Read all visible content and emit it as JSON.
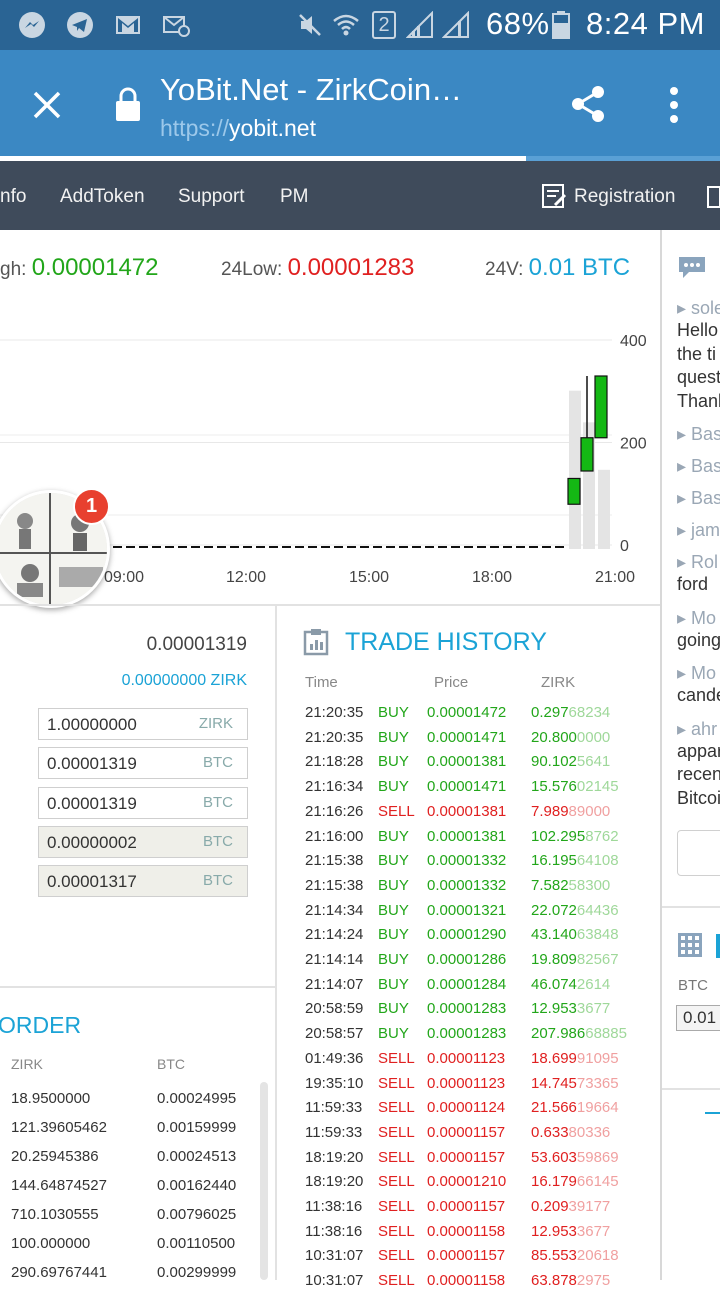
{
  "status_bar": {
    "battery": "68%",
    "time": "8:24 PM",
    "sim_badge": "2",
    "icons": [
      "messenger-icon",
      "telegram-icon",
      "gmail-icon",
      "email-icon",
      "mute-icon",
      "wifi-icon",
      "signal-icon",
      "battery-icon"
    ]
  },
  "browser": {
    "title": "YoBit.Net - ZirkCoin…",
    "url_scheme": "https://",
    "url_host": "yobit.net",
    "load_progress": 0.73
  },
  "nav": {
    "items": [
      "nfo",
      "AddToken",
      "Support",
      "PM"
    ],
    "registration": "Registration"
  },
  "stats": {
    "high_label": "gh:",
    "high_value": "0.00001472",
    "low_label": "24Low:",
    "low_value": "0.00001283",
    "vol_label": "24V:",
    "vol_value": "0.01 BTC"
  },
  "chart_data": {
    "type": "candlestick",
    "x_ticks": [
      "09:00",
      "12:00",
      "15:00",
      "18:00",
      "21:00"
    ],
    "y_ticks": [
      "400",
      "200",
      "0"
    ],
    "ylim": [
      0,
      400
    ],
    "candles": [
      {
        "open": 1283,
        "close": 1321,
        "low": 1283,
        "high": 1321
      },
      {
        "open": 1332,
        "close": 1381,
        "low": 1332,
        "high": 1472
      },
      {
        "open": 1381,
        "close": 1472,
        "low": 1381,
        "high": 1472
      }
    ],
    "volume_bars": [
      0,
      0.01,
      0.008,
      0.005
    ]
  },
  "chat_head": {
    "badge": "1"
  },
  "buy_form": {
    "price": "0.00001319",
    "balance": "0.00000000 ZIRK",
    "fields": [
      {
        "value": "1.00000000",
        "unit": "ZIRK",
        "readonly": false
      },
      {
        "value": "0.00001319",
        "unit": "BTC",
        "readonly": false
      },
      {
        "value": "0.00001319",
        "unit": "BTC",
        "readonly": false
      },
      {
        "value": "0.00000002",
        "unit": "BTC",
        "readonly": true
      },
      {
        "value": "0.00001317",
        "unit": "BTC",
        "readonly": true
      }
    ]
  },
  "orders": {
    "title": "ORDER",
    "col_zirk": "ZIRK",
    "col_btc": "BTC",
    "rows": [
      [
        "18.9500000",
        "0.00024995"
      ],
      [
        "121.39605462",
        "0.00159999"
      ],
      [
        "20.25945386",
        "0.00024513"
      ],
      [
        "144.64874527",
        "0.00162440"
      ],
      [
        "710.1030555",
        "0.00796025"
      ],
      [
        "100.000000",
        "0.00110500"
      ],
      [
        "290.69767441",
        "0.00299999"
      ]
    ]
  },
  "trade_history": {
    "title": "TRADE HISTORY",
    "col_time": "Time",
    "col_price": "Price",
    "col_amount": "ZIRK",
    "rows": [
      {
        "time": "21:20:35",
        "type": "BUY",
        "price": "0.00001472",
        "amt_main": "0.297",
        "amt_fade": "68234"
      },
      {
        "time": "21:20:35",
        "type": "BUY",
        "price": "0.00001471",
        "amt_main": "20.800",
        "amt_fade": "0000"
      },
      {
        "time": "21:18:28",
        "type": "BUY",
        "price": "0.00001381",
        "amt_main": "90.102",
        "amt_fade": "5641"
      },
      {
        "time": "21:16:34",
        "type": "BUY",
        "price": "0.00001471",
        "amt_main": "15.576",
        "amt_fade": "02145"
      },
      {
        "time": "21:16:26",
        "type": "SELL",
        "price": "0.00001381",
        "amt_main": "7.989",
        "amt_fade": "89000"
      },
      {
        "time": "21:16:00",
        "type": "BUY",
        "price": "0.00001381",
        "amt_main": "102.295",
        "amt_fade": "8762"
      },
      {
        "time": "21:15:38",
        "type": "BUY",
        "price": "0.00001332",
        "amt_main": "16.195",
        "amt_fade": "64108"
      },
      {
        "time": "21:15:38",
        "type": "BUY",
        "price": "0.00001332",
        "amt_main": "7.582",
        "amt_fade": "58300"
      },
      {
        "time": "21:14:34",
        "type": "BUY",
        "price": "0.00001321",
        "amt_main": "22.072",
        "amt_fade": "64436"
      },
      {
        "time": "21:14:24",
        "type": "BUY",
        "price": "0.00001290",
        "amt_main": "43.140",
        "amt_fade": "63848"
      },
      {
        "time": "21:14:14",
        "type": "BUY",
        "price": "0.00001286",
        "amt_main": "19.809",
        "amt_fade": "82567"
      },
      {
        "time": "21:14:07",
        "type": "BUY",
        "price": "0.00001284",
        "amt_main": "46.074",
        "amt_fade": "2614"
      },
      {
        "time": "20:58:59",
        "type": "BUY",
        "price": "0.00001283",
        "amt_main": "12.953",
        "amt_fade": "3677"
      },
      {
        "time": "20:58:57",
        "type": "BUY",
        "price": "0.00001283",
        "amt_main": "207.986",
        "amt_fade": "68885"
      },
      {
        "time": "01:49:36",
        "type": "SELL",
        "price": "0.00001123",
        "amt_main": "18.699",
        "amt_fade": "91095"
      },
      {
        "time": "19:35:10",
        "type": "SELL",
        "price": "0.00001123",
        "amt_main": "14.745",
        "amt_fade": "73365"
      },
      {
        "time": "11:59:33",
        "type": "SELL",
        "price": "0.00001124",
        "amt_main": "21.566",
        "amt_fade": "19664"
      },
      {
        "time": "11:59:33",
        "type": "SELL",
        "price": "0.00001157",
        "amt_main": "0.633",
        "amt_fade": "80336"
      },
      {
        "time": "18:19:20",
        "type": "SELL",
        "price": "0.00001157",
        "amt_main": "53.603",
        "amt_fade": "59869"
      },
      {
        "time": "18:19:20",
        "type": "SELL",
        "price": "0.00001210",
        "amt_main": "16.179",
        "amt_fade": "66145"
      },
      {
        "time": "11:38:16",
        "type": "SELL",
        "price": "0.00001157",
        "amt_main": "0.209",
        "amt_fade": "39177"
      },
      {
        "time": "11:38:16",
        "type": "SELL",
        "price": "0.00001158",
        "amt_main": "12.953",
        "amt_fade": "3677"
      },
      {
        "time": "10:31:07",
        "type": "SELL",
        "price": "0.00001157",
        "amt_main": "85.553",
        "amt_fade": "20618"
      },
      {
        "time": "10:31:07",
        "type": "SELL",
        "price": "0.00001158",
        "amt_main": "63.878",
        "amt_fade": "2975"
      }
    ]
  },
  "chat": {
    "entries": [
      {
        "link": "sole",
        "text": [
          "Hello",
          "the ti",
          "quest",
          "Thank"
        ]
      },
      {
        "link": "Bas",
        "text": []
      },
      {
        "link": "Bas",
        "text": []
      },
      {
        "link": "Bas",
        "text": []
      },
      {
        "link": "jam",
        "text": []
      },
      {
        "link": "Rol",
        "text": [
          "ford"
        ]
      },
      {
        "link": "Mo",
        "text": [
          "going"
        ]
      },
      {
        "link": "Mo",
        "text": [
          "cande"
        ]
      },
      {
        "link": "ahr",
        "text": [
          "appar",
          "recen",
          "Bitcoi"
        ]
      }
    ]
  },
  "right_calc": {
    "label": "BTC",
    "value": "0.01"
  },
  "colors": {
    "status_bar": "#2a6494",
    "chrome_bar": "#3b88c3",
    "nav_bar": "#3f4b5b",
    "buy": "#22a61a",
    "sell": "#e02020",
    "accent": "#1ba3d6",
    "candle": "#14b814"
  }
}
